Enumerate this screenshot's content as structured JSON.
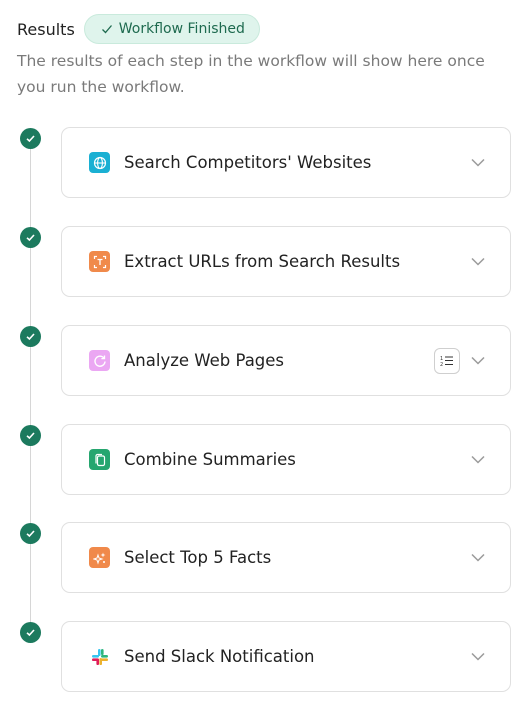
{
  "header": {
    "title": "Results",
    "badge": "Workflow Finished",
    "description": "The results of each step in the workflow will show here once you run the workflow."
  },
  "steps": [
    {
      "label": "Search Competitors' Websites",
      "icon": "globe-icon",
      "icon_color": "#1ab0d3",
      "status": "complete"
    },
    {
      "label": "Extract URLs from Search Results",
      "icon": "text-extract-icon",
      "icon_color": "#f08a4b",
      "status": "complete"
    },
    {
      "label": "Analyze Web Pages",
      "icon": "refresh-icon",
      "icon_color": "#eba7f3",
      "status": "complete",
      "has_list_button": true
    },
    {
      "label": "Combine Summaries",
      "icon": "copy-icon",
      "icon_color": "#26a66f",
      "status": "complete"
    },
    {
      "label": "Select Top 5 Facts",
      "icon": "sparkles-icon",
      "icon_color": "#f0894a",
      "status": "complete"
    },
    {
      "label": "Send Slack Notification",
      "icon": "slack-icon",
      "icon_color": "",
      "status": "complete"
    }
  ],
  "colors": {
    "success": "#1c7a5e",
    "badge_bg": "#dff4ec",
    "badge_text": "#1e6a4f"
  }
}
